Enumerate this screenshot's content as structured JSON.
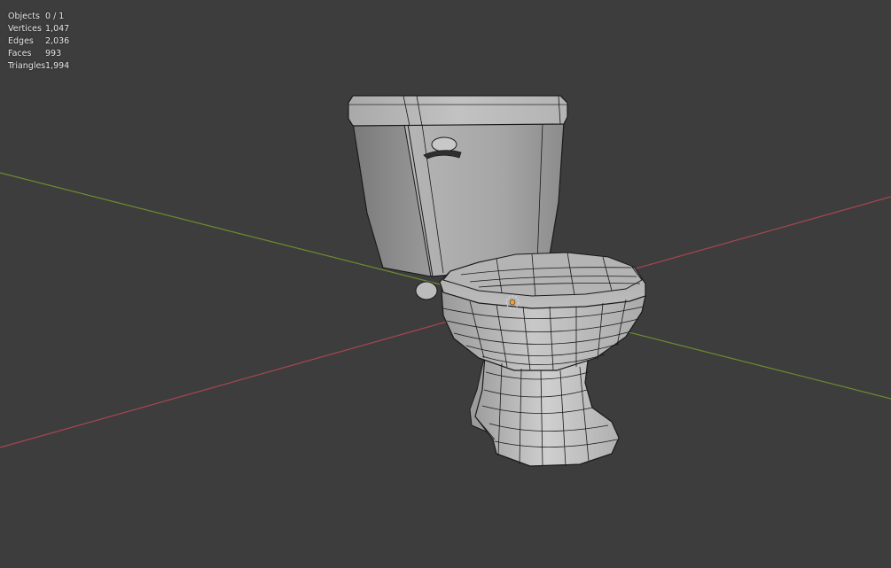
{
  "viewport": {
    "background_color": "#3d3d3d",
    "x_axis_color": "#a8464f",
    "y_axis_color": "#6b8c2f"
  },
  "stats": {
    "objects": {
      "label": "Objects",
      "value": "0 / 1"
    },
    "vertices": {
      "label": "Vertices",
      "value": "1,047"
    },
    "edges": {
      "label": "Edges",
      "value": "2,036"
    },
    "faces": {
      "label": "Faces",
      "value": "993"
    },
    "triangles": {
      "label": "Triangles",
      "value": "1,994"
    }
  },
  "scene": {
    "object": "toilet-mesh",
    "shading": "solid-wireframe",
    "origin_marker": "object-origin-icon"
  }
}
